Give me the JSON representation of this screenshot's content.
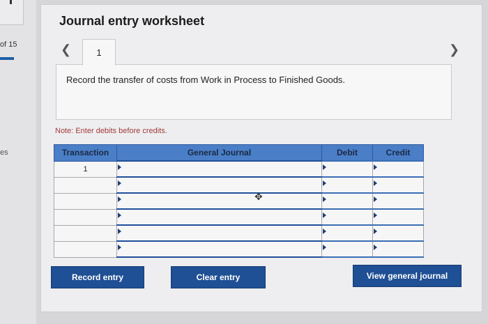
{
  "sidebar": {
    "page_of": "of 15",
    "section_abbrev": "es"
  },
  "worksheet": {
    "title": "Journal entry worksheet",
    "current_tab": "1",
    "prev_icon": "chevron-left-icon",
    "next_icon": "chevron-right-icon",
    "prompt": "Record the transfer of costs from Work in Process to Finished Goods.",
    "note": "Note: Enter debits before credits.",
    "columns": [
      "Transaction",
      "General Journal",
      "Debit",
      "Credit"
    ],
    "rows": [
      {
        "transaction": "1",
        "general_journal": "",
        "debit": "",
        "credit": ""
      },
      {
        "transaction": "",
        "general_journal": "",
        "debit": "",
        "credit": ""
      },
      {
        "transaction": "",
        "general_journal": "",
        "debit": "",
        "credit": ""
      },
      {
        "transaction": "",
        "general_journal": "",
        "debit": "",
        "credit": ""
      },
      {
        "transaction": "",
        "general_journal": "",
        "debit": "",
        "credit": ""
      },
      {
        "transaction": "",
        "general_journal": "",
        "debit": "",
        "credit": ""
      }
    ]
  },
  "buttons": {
    "record": "Record entry",
    "clear": "Clear entry",
    "view": "View general journal"
  },
  "colors": {
    "accent": "#1f4f94",
    "header": "#4a7ec7",
    "note": "#a23a3a"
  }
}
